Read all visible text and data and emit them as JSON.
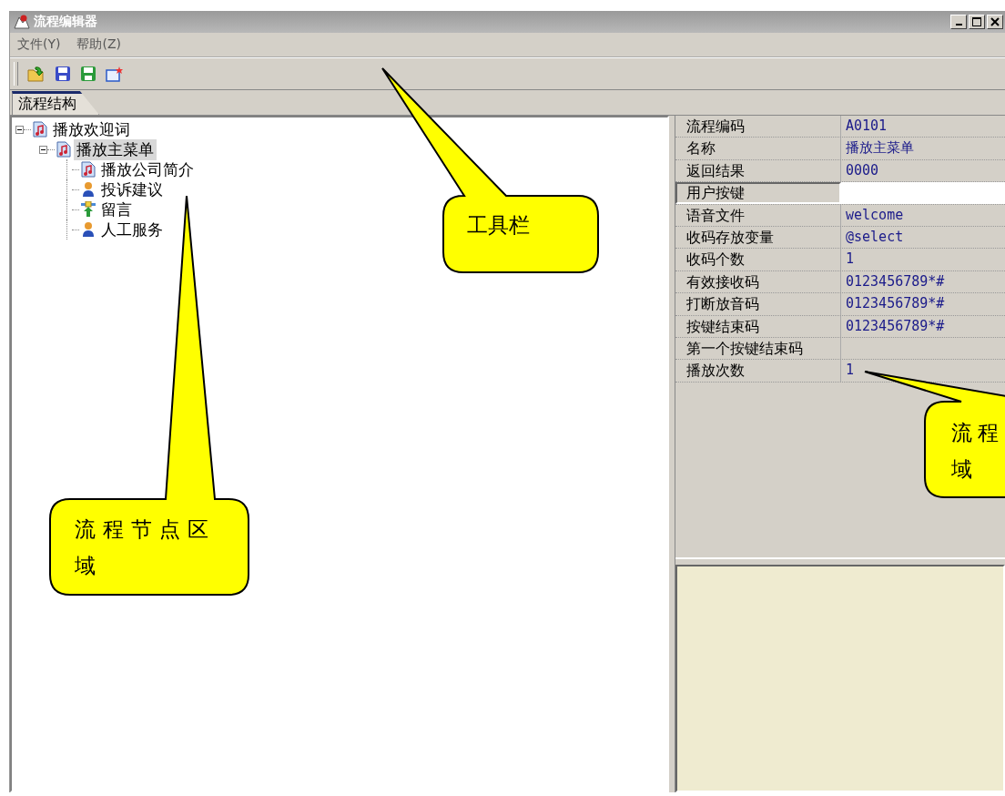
{
  "window": {
    "title": "流程编辑器"
  },
  "menu": [
    {
      "label": "文件(Y)"
    },
    {
      "label": "帮助(Z)"
    }
  ],
  "toolbar": [
    {
      "kind": "open"
    },
    {
      "kind": "save"
    },
    {
      "kind": "save-as"
    },
    {
      "kind": "new"
    }
  ],
  "tabs": [
    {
      "label": "流程结构",
      "selected": true
    }
  ],
  "tree": [
    {
      "label": "播放欢迎词",
      "kind": "audio",
      "selected": false,
      "expanded": true,
      "children": [
        {
          "label": "播放主菜单",
          "kind": "audio",
          "selected": true,
          "expanded": true,
          "children": [
            {
              "label": "播放公司简介",
              "kind": "audio",
              "selected": false
            },
            {
              "label": "投诉建议",
              "kind": "person",
              "selected": false
            },
            {
              "label": "留言",
              "kind": "record",
              "selected": false
            },
            {
              "label": "人工服务",
              "kind": "person",
              "selected": false
            }
          ]
        }
      ]
    }
  ],
  "properties": [
    {
      "name": "流程编码",
      "value": "A0101",
      "selected": false
    },
    {
      "name": "名称",
      "value": "播放主菜单",
      "selected": false
    },
    {
      "name": "返回结果",
      "value": "0000",
      "selected": false
    },
    {
      "name": "用户按键",
      "selected": true
    },
    {
      "name": "语音文件",
      "value": "welcome",
      "selected": false
    },
    {
      "name": "收码存放变量",
      "value": "@select",
      "selected": false
    },
    {
      "name": "收码个数",
      "value": "1",
      "selected": false
    },
    {
      "name": "有效接收码",
      "value": "0123456789*#",
      "selected": false
    },
    {
      "name": "打断放音码",
      "value": "0123456789*#",
      "selected": false
    },
    {
      "name": "按键结束码",
      "value": "0123456789*#",
      "selected": false
    },
    {
      "name": "第一个按键结束码",
      "selected": false
    },
    {
      "name": "播放次数",
      "value": "1",
      "selected": false
    }
  ],
  "callouts": [
    {
      "lines": [
        "工具栏"
      ]
    },
    {
      "lines": [
        "流程节点区",
        "域"
      ]
    },
    {
      "lines": [
        "流程",
        "域"
      ]
    }
  ]
}
